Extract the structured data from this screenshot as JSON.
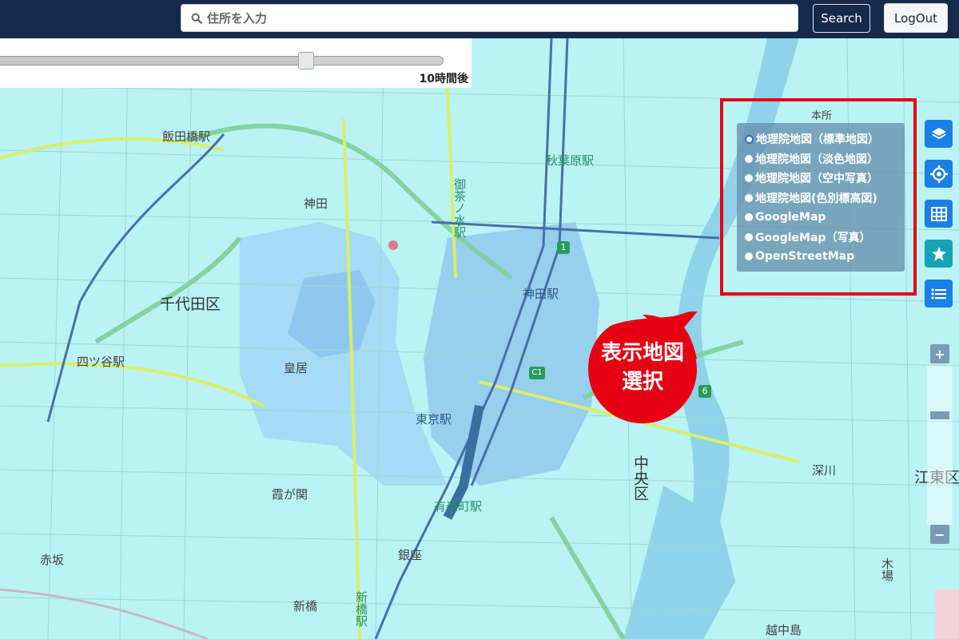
{
  "header": {
    "search_placeholder": "住所を入力",
    "search_button": "Search",
    "logout_button": "LogOut"
  },
  "time_slider": {
    "label": "10時間後",
    "value_fraction": 0.69
  },
  "map": {
    "places": {
      "iidabashi": "飯田橋駅",
      "akihabara": "秋葉原駅",
      "kanda": "神田",
      "ochanomizu": "御茶ノ水駅",
      "chiyoda": "千代田区",
      "kandaeki": "神田駅",
      "yotsuya": "四ツ谷駅",
      "kokyo": "皇居",
      "tokyo": "東京駅",
      "kasumigaseki": "霞が関",
      "yurakucho": "有楽町駅",
      "ginza": "銀座",
      "akasaka": "赤坂",
      "shinbashi": "新橋",
      "shinbashieki": "新橋駅",
      "chuo": "中央区",
      "fukagawa": "深川",
      "koto": "江東区",
      "honjo": "本所",
      "kiba": "木場",
      "etchujima": "越中島"
    },
    "route_badges": {
      "r1": "1",
      "c1": "C1",
      "r6": "6"
    }
  },
  "layer_menu": {
    "items": [
      {
        "label": "地理院地図（標準地図）",
        "selected": true
      },
      {
        "label": "地理院地図（淡色地図）",
        "selected": false
      },
      {
        "label": "地理院地図（空中写真）",
        "selected": false
      },
      {
        "label": "地理院地図(色別標高図)",
        "selected": false
      },
      {
        "label": "GoogleMap",
        "selected": false
      },
      {
        "label": "GoogleMap（写真）",
        "selected": false
      },
      {
        "label": "OpenStreetMap",
        "selected": false
      }
    ]
  },
  "side_buttons": {
    "layers_color": "#1a7fe6",
    "location_color": "#1a7fe6",
    "grid_color": "#1a7fe6",
    "favorite_color": "#17a2b8",
    "list_color": "#1a7fe6"
  },
  "zoom": {
    "plus": "+",
    "minus": "−"
  },
  "callout": {
    "line1": "表示地図",
    "line2": "選択",
    "color": "#e60012"
  }
}
